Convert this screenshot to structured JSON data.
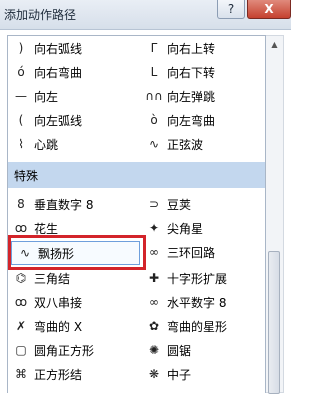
{
  "window": {
    "title": "添加动作路径",
    "help_label": "?",
    "close_label": "X"
  },
  "items": [
    {
      "left": {
        "icon": "arc-right-icon",
        "glyph": ")",
        "label": "向右弧线"
      },
      "right": {
        "icon": "turn-right-up-icon",
        "glyph": "Γ",
        "label": "向右上转"
      }
    },
    {
      "left": {
        "icon": "curve-right-icon",
        "glyph": "ó",
        "label": "向右弯曲"
      },
      "right": {
        "icon": "turn-right-down-icon",
        "glyph": "L",
        "label": "向右下转"
      }
    },
    {
      "left": {
        "icon": "line-left-icon",
        "glyph": "—",
        "label": "向左"
      },
      "right": {
        "icon": "bounce-left-icon",
        "glyph": "∩∩",
        "label": "向左弹跳"
      }
    },
    {
      "left": {
        "icon": "arc-left-icon",
        "glyph": "(",
        "label": "向左弧线"
      },
      "right": {
        "icon": "curve-left-icon",
        "glyph": "ò",
        "label": "向左弯曲"
      }
    },
    {
      "left": {
        "icon": "heartbeat-icon",
        "glyph": "⌇",
        "label": "心跳"
      },
      "right": {
        "icon": "sine-wave-icon",
        "glyph": "∿",
        "label": "正弦波"
      }
    }
  ],
  "section_label": "特殊",
  "special_items": [
    {
      "left": {
        "icon": "vertical-eight-icon",
        "glyph": "8",
        "label": "垂直数字 8"
      },
      "right": {
        "icon": "bean-icon",
        "glyph": "⊃",
        "label": "豆荚"
      }
    },
    {
      "left": {
        "icon": "peanut-icon",
        "glyph": "ꝏ",
        "label": "花生"
      },
      "right": {
        "icon": "pointed-star-icon",
        "glyph": "✦",
        "label": "尖角星"
      }
    },
    {
      "left": {
        "icon": "flutter-icon",
        "glyph": "∿",
        "label": "飘扬形",
        "selected": true
      },
      "right": {
        "icon": "three-loop-icon",
        "glyph": "∞",
        "label": "三环回路"
      }
    },
    {
      "left": {
        "icon": "triangle-knot-icon",
        "glyph": "⌬",
        "label": "三角结"
      },
      "right": {
        "icon": "cross-expand-icon",
        "glyph": "✚",
        "label": "十字形扩展"
      }
    },
    {
      "left": {
        "icon": "double-string-icon",
        "glyph": "ꝏ",
        "label": "双八串接"
      },
      "right": {
        "icon": "horizontal-eight-icon",
        "glyph": "∞",
        "label": "水平数字 8"
      }
    },
    {
      "left": {
        "icon": "curved-x-icon",
        "glyph": "✗",
        "label": "弯曲的 X"
      },
      "right": {
        "icon": "curved-star-icon",
        "glyph": "✿",
        "label": "弯曲的星形"
      }
    },
    {
      "left": {
        "icon": "rounded-square-icon",
        "glyph": "▢",
        "label": "圆角正方形"
      },
      "right": {
        "icon": "circle-saw-icon",
        "glyph": "✺",
        "label": "圆锯"
      }
    },
    {
      "left": {
        "icon": "square-knot-icon",
        "glyph": "⌘",
        "label": "正方形结"
      },
      "right": {
        "icon": "neutron-icon",
        "glyph": "❋",
        "label": "中子"
      }
    }
  ],
  "scrollbar": {
    "up_arrow": "▲"
  },
  "colors": {
    "section_bg": "#c3d7ee",
    "highlight": "#d3242a"
  }
}
